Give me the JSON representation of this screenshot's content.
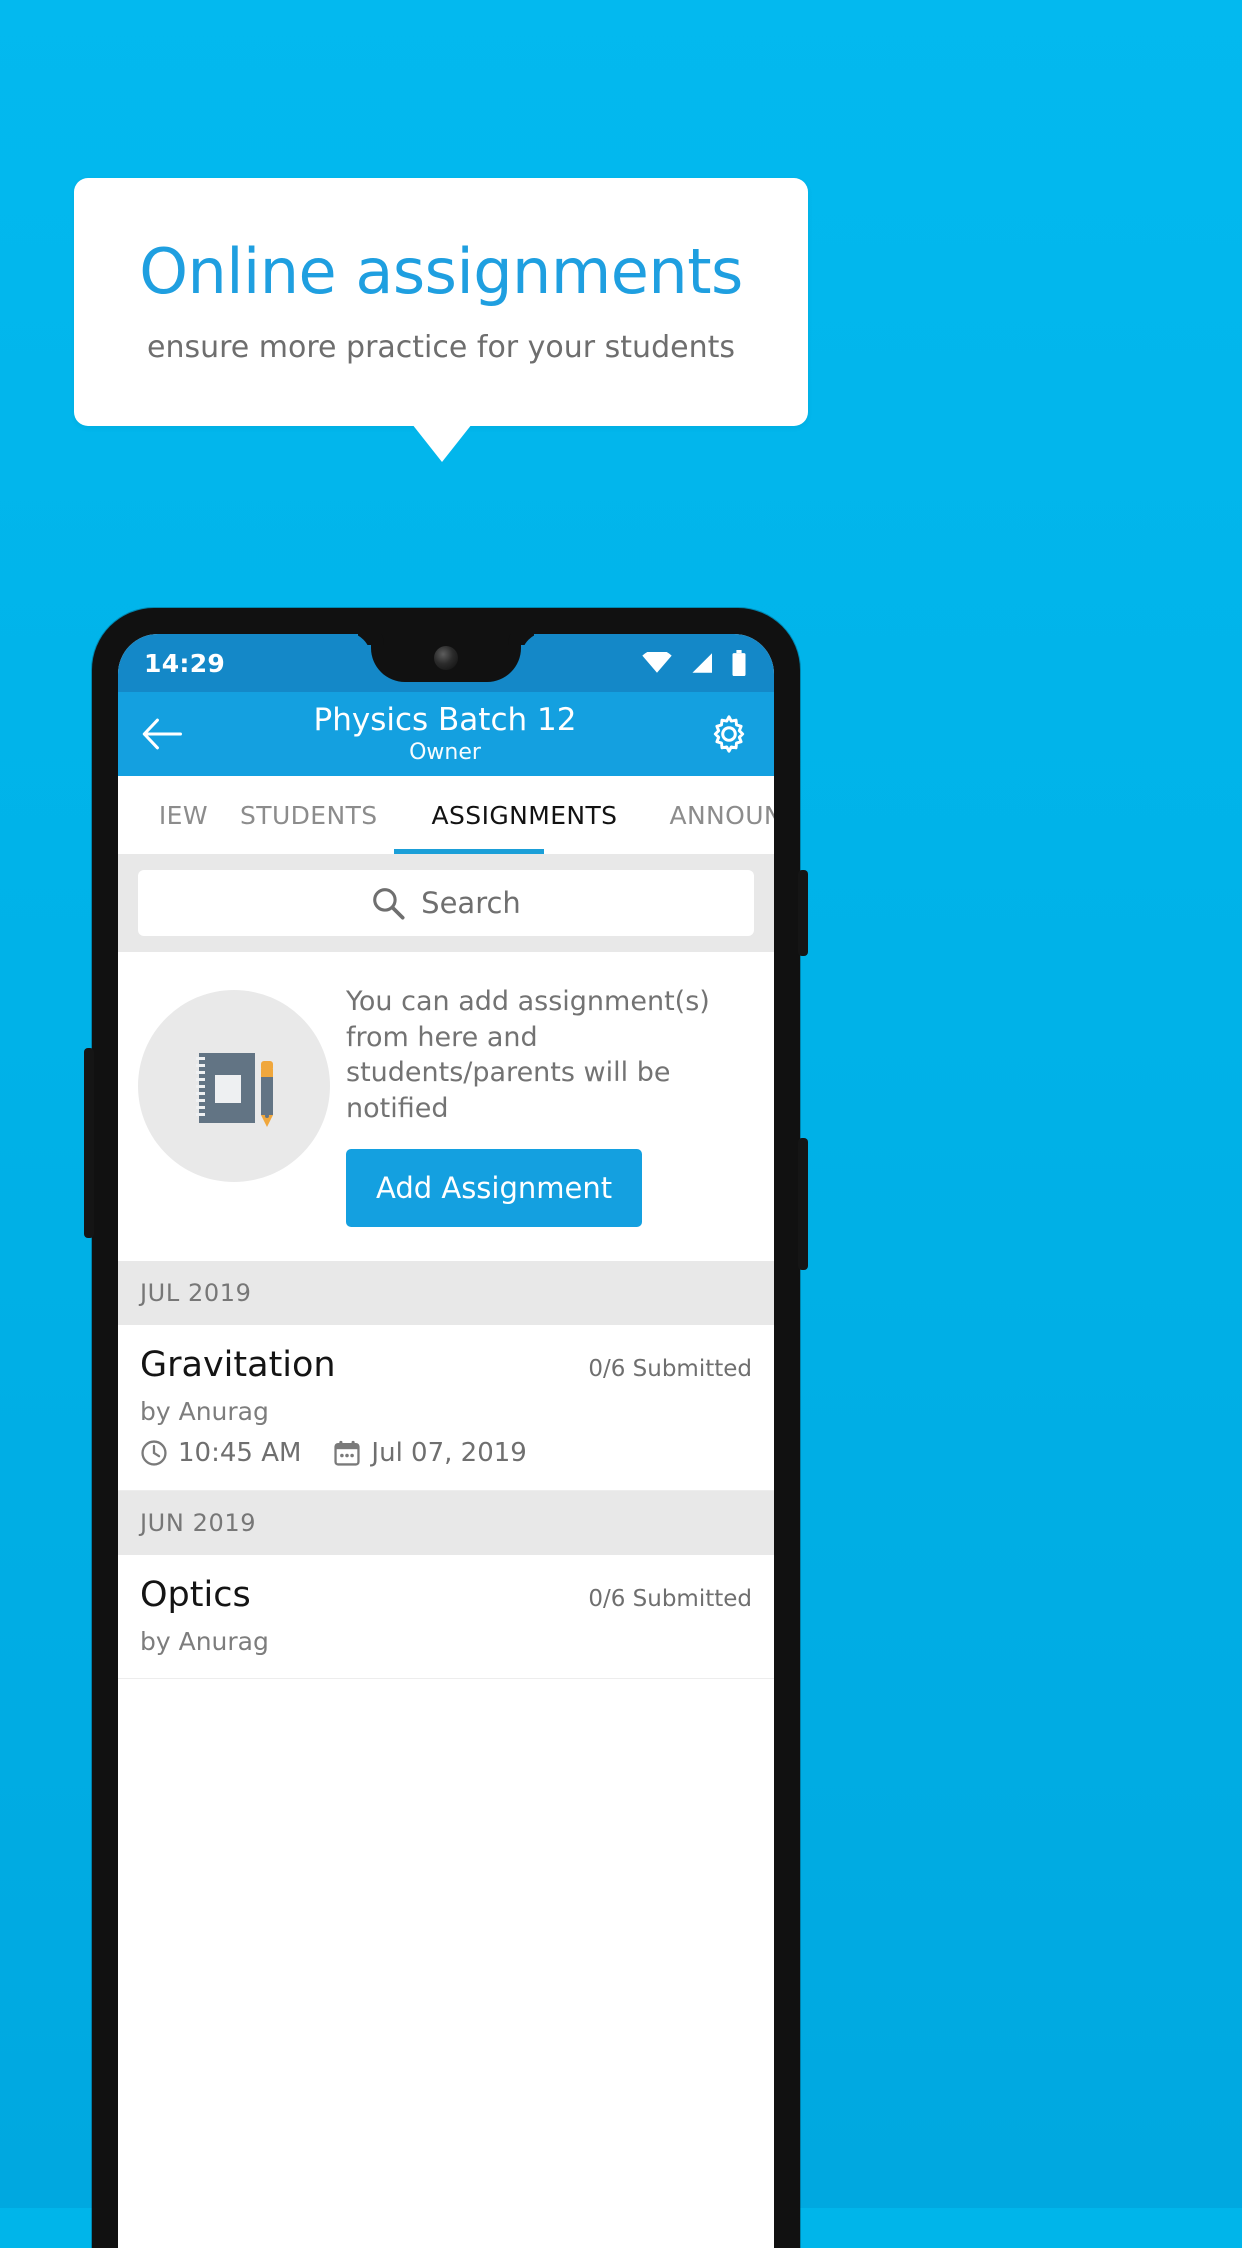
{
  "promo": {
    "title": "Online assignments",
    "subtitle": "ensure more practice for your students",
    "title_color": "#1f9fe0",
    "background_color": "#00b2e8"
  },
  "phone": {
    "status_bar": {
      "clock": "14:29",
      "icons": [
        "wifi-icon",
        "signal-icon",
        "battery-icon"
      ],
      "background_color": "#1488c8"
    },
    "app_bar": {
      "back_icon": "back-arrow-icon",
      "title": "Physics Batch 12",
      "subtitle": "Owner",
      "settings_icon": "gear-icon",
      "background_color": "#14a0e0"
    },
    "tabs": {
      "items": [
        {
          "label": "IEW",
          "active": false
        },
        {
          "label": "STUDENTS",
          "active": false
        },
        {
          "label": "ASSIGNMENTS",
          "active": true
        },
        {
          "label": "ANNOUNCEI",
          "active": false
        }
      ],
      "indicator_color": "#1b9fd8"
    },
    "search": {
      "icon": "search-icon",
      "placeholder": "Search",
      "value": ""
    },
    "empty_state": {
      "illustration": "notebook-and-pen-icon",
      "message": "You can add assignment(s) from here and students/parents will be notified",
      "button_label": "Add Assignment",
      "button_color": "#14a0e0"
    },
    "assignment_groups": [
      {
        "month": "JUL 2019",
        "items": [
          {
            "title": "Gravitation",
            "submitted": "0/6 Submitted",
            "author": "by Anurag",
            "time_icon": "clock-icon",
            "time": "10:45 AM",
            "date_icon": "calendar-icon",
            "date": "Jul 07, 2019"
          }
        ]
      },
      {
        "month": "JUN 2019",
        "items": [
          {
            "title": "Optics",
            "submitted": "0/6 Submitted",
            "author": "by Anurag",
            "time_icon": "clock-icon",
            "time": "",
            "date_icon": "calendar-icon",
            "date": ""
          }
        ]
      }
    ]
  }
}
